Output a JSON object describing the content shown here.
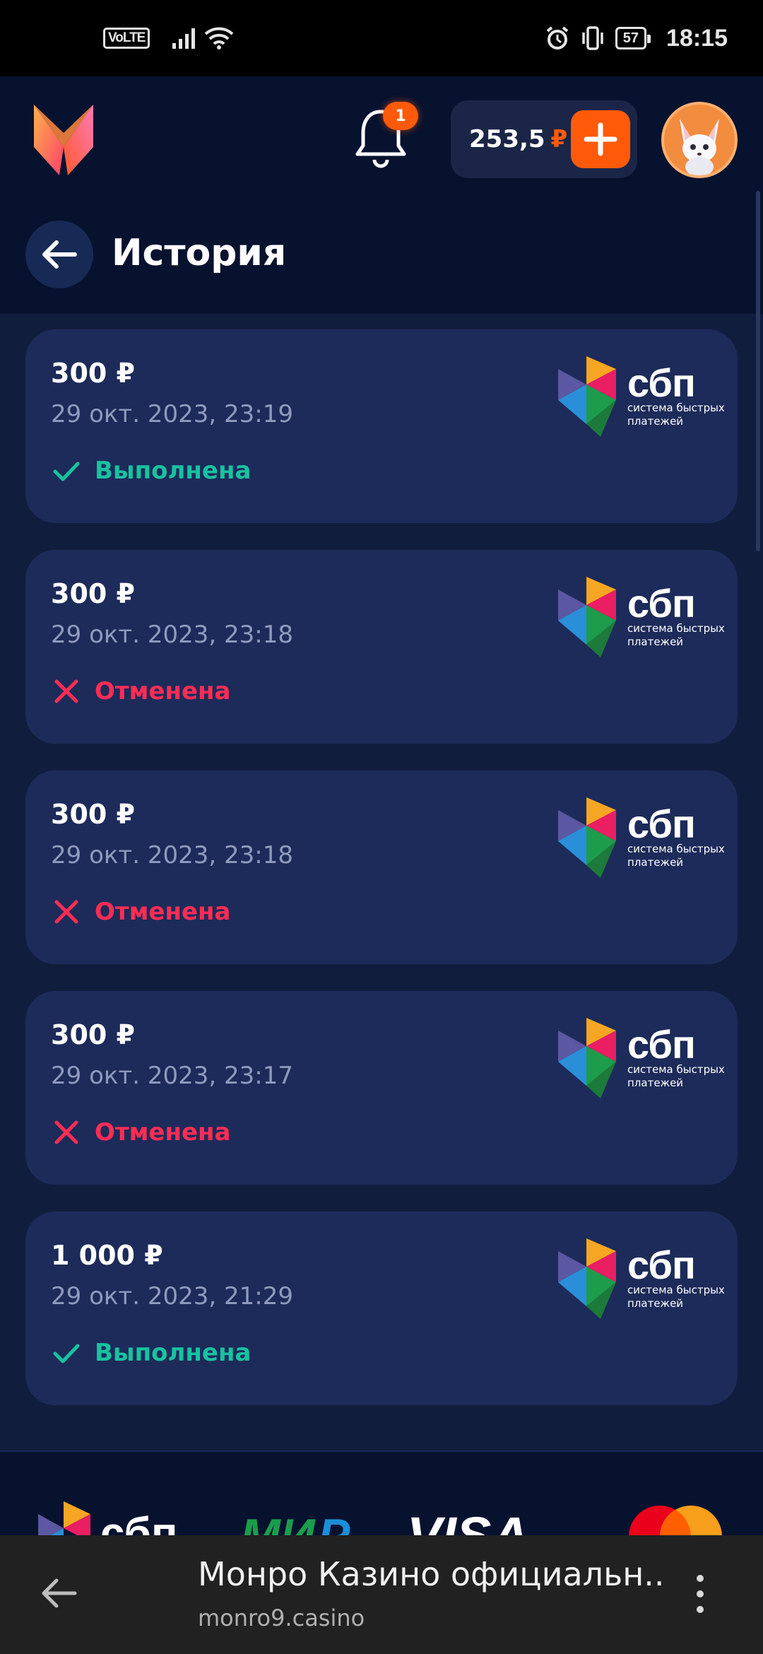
{
  "status_bar": {
    "volte": "VoLTE",
    "battery": "57",
    "time": "18:15"
  },
  "header": {
    "notification_count": "1",
    "balance_amount": "253,5",
    "balance_currency": "₽",
    "accent_color": "#ff5a0a"
  },
  "page": {
    "title": "История"
  },
  "sbp": {
    "word": "сбп",
    "sub_line1": "система быстрых",
    "sub_line2": "платежей"
  },
  "transactions": [
    {
      "amount": "300 ₽",
      "date": "29 окт. 2023, 23:19",
      "status": "Выполнена",
      "state": "done"
    },
    {
      "amount": "300 ₽",
      "date": "29 окт. 2023, 23:18",
      "status": "Отменена",
      "state": "cancel"
    },
    {
      "amount": "300 ₽",
      "date": "29 окт. 2023, 23:18",
      "status": "Отменена",
      "state": "cancel"
    },
    {
      "amount": "300 ₽",
      "date": "29 окт. 2023, 23:17",
      "status": "Отменена",
      "state": "cancel"
    },
    {
      "amount": "1 000 ₽",
      "date": "29 окт. 2023, 21:29",
      "status": "Выполнена",
      "state": "done"
    }
  ],
  "status_colors": {
    "done": "#18c2a0",
    "cancel": "#ff2d55"
  },
  "browser": {
    "page_title": "Монро Казино официальн...",
    "url": "monro9.casino"
  },
  "icons": [
    "volte-icon",
    "signal-icon",
    "wifi-icon",
    "alarm-icon",
    "vibrate-icon",
    "battery-icon",
    "logo-icon",
    "bell-icon",
    "plus-icon",
    "avatar-fox",
    "back-arrow-icon",
    "check-icon",
    "cross-icon",
    "sbp-logo",
    "mir-logo",
    "visa-logo",
    "mastercard-logo",
    "menu-dots-icon"
  ]
}
